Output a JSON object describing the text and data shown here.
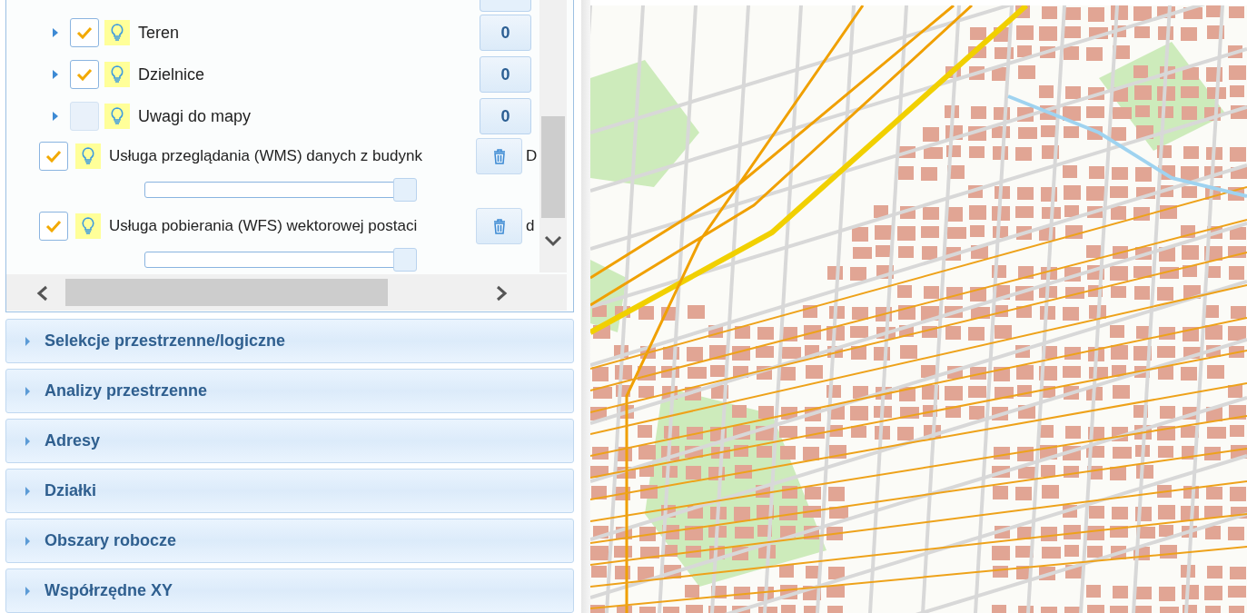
{
  "layers": [
    {
      "kind": "group",
      "label": "Teren",
      "checked": true,
      "count": "0"
    },
    {
      "kind": "group",
      "label": "Dzielnice",
      "checked": true,
      "count": "0"
    },
    {
      "kind": "group",
      "label": "Uwagi do mapy",
      "checked": false,
      "count": "0"
    },
    {
      "kind": "service",
      "label": "Usługa przeglądania (WMS) danych z budynk",
      "overflow": "D",
      "checked": true,
      "level": 1
    },
    {
      "kind": "service",
      "label": "Usługa pobierania (WFS) wektorowej postaci",
      "overflow": "d",
      "checked": true,
      "level": 1
    }
  ],
  "sections": [
    {
      "title": "Selekcje przestrzenne/logiczne",
      "expanded": false
    },
    {
      "title": "Analizy przestrzenne",
      "expanded": false
    },
    {
      "title": "Adresy",
      "expanded": false
    },
    {
      "title": "Działki",
      "expanded": false
    },
    {
      "title": "Obszary robocze",
      "expanded": false
    },
    {
      "title": "Współrzędne XY",
      "expanded": false
    }
  ]
}
